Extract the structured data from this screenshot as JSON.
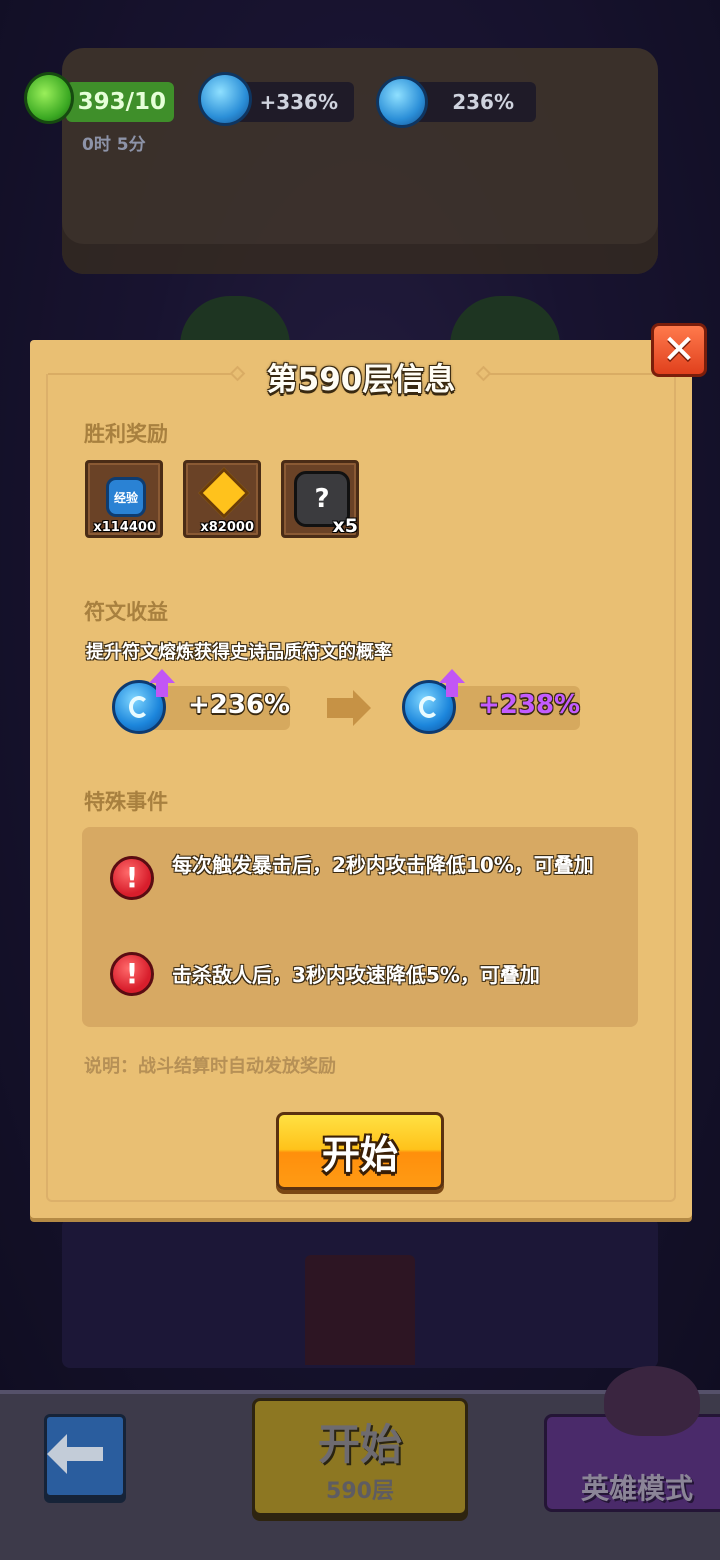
{
  "hud": {
    "energy": "393/10",
    "timer": "0时 5分",
    "speed_bonus": "+336%",
    "rune_bonus": "236%"
  },
  "dialog": {
    "title": "第590层信息",
    "close": "✕",
    "victory_rewards": {
      "title": "胜利奖励",
      "items": [
        {
          "icon": "exp-badge-icon",
          "label": "经验",
          "count": "x114400"
        },
        {
          "icon": "bow-diamond-icon",
          "count": "x82000"
        },
        {
          "icon": "mystery-puzzle-icon",
          "label": "?",
          "count": "x5"
        }
      ]
    },
    "rune_income": {
      "title": "符文收益",
      "description": "提升符文熔炼获得史诗品质符文的概率",
      "current": "+236%",
      "next": "+238%"
    },
    "special_events": {
      "title": "特殊事件",
      "items": [
        "每次触发暴击后，2秒内攻击降低10%，可叠加",
        "击杀敌人后，3秒内攻速降低5%，可叠加"
      ]
    },
    "note": "说明：战斗结算时自动发放奖励",
    "start_button": "开始"
  },
  "bottom": {
    "start_label": "开始",
    "floor": "590层",
    "hero_mode": "英雄模式"
  },
  "colors": {
    "panel": "#e9bf73",
    "section_title": "#a8803f",
    "purple_value": "#c45cff",
    "start_orange": "#ff9b14"
  }
}
